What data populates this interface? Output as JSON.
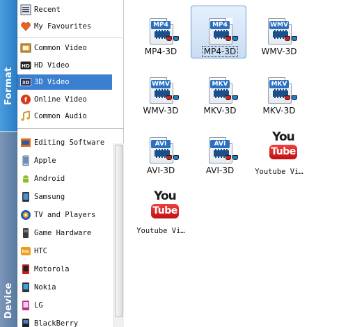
{
  "tabs": {
    "format": "Format",
    "device": "Device"
  },
  "sidebar": {
    "top_items": [
      {
        "label": "Recent",
        "icon": "recent-icon"
      },
      {
        "label": "My Favourites",
        "icon": "heart-icon"
      }
    ],
    "format_items": [
      {
        "label": "Common Video",
        "icon": "film-icon"
      },
      {
        "label": "HD Video",
        "icon": "hd-icon"
      },
      {
        "label": "3D Video",
        "icon": "3d-icon",
        "selected": true
      },
      {
        "label": "Online Video",
        "icon": "online-video-icon"
      },
      {
        "label": "Common Audio",
        "icon": "music-note-icon"
      }
    ],
    "device_items": [
      {
        "label": "Editing Software",
        "icon": "editing-software-icon"
      },
      {
        "label": "Apple",
        "icon": "apple-icon"
      },
      {
        "label": "Android",
        "icon": "android-icon"
      },
      {
        "label": "Samsung",
        "icon": "samsung-phone-icon"
      },
      {
        "label": "TV and Players",
        "icon": "tv-icon"
      },
      {
        "label": "Game Hardware",
        "icon": "game-console-icon"
      },
      {
        "label": "HTC",
        "icon": "htc-icon"
      },
      {
        "label": "Motorola",
        "icon": "motorola-icon"
      },
      {
        "label": "Nokia",
        "icon": "nokia-icon"
      },
      {
        "label": "LG",
        "icon": "lg-icon"
      },
      {
        "label": "BlackBerry",
        "icon": "blackberry-icon"
      }
    ]
  },
  "formats": [
    {
      "label": "MP4-3D",
      "badge": "MP4",
      "badge_color": "#2a6fc0"
    },
    {
      "label": "MP4-3D",
      "badge": "MP4",
      "badge_color": "#2a6fc0",
      "selected": true
    },
    {
      "label": "WMV-3D",
      "badge": "WMV",
      "badge_color": "#2a6fc0"
    },
    {
      "label": "WMV-3D",
      "badge": "WMV",
      "badge_color": "#2a6fc0"
    },
    {
      "label": "MKV-3D",
      "badge": "MKV",
      "badge_color": "#2a6fc0"
    },
    {
      "label": "MKV-3D",
      "badge": "MKV",
      "badge_color": "#2a6fc0"
    },
    {
      "label": "AVI-3D",
      "badge": "AVI",
      "badge_color": "#2a6fc0"
    },
    {
      "label": "AVI-3D",
      "badge": "AVI",
      "badge_color": "#2a6fc0"
    },
    {
      "label": "Youtube Vi…",
      "logo_top": "You",
      "logo_bottom": "Tube"
    },
    {
      "label": "Youtube Vi…",
      "logo_top": "You",
      "logo_bottom": "Tube"
    }
  ],
  "colors": {
    "selection": "#3a7fd0",
    "format_tab": "#2b7ec6",
    "device_tab": "#5a7aa0",
    "youtube_red": "#d42020"
  }
}
